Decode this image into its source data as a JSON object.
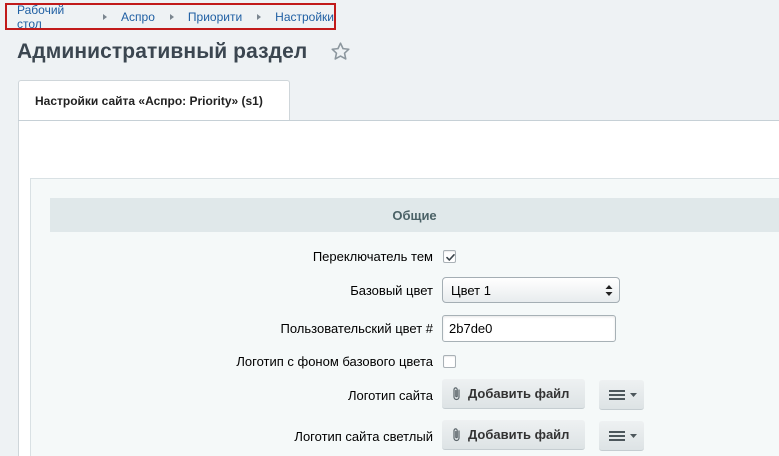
{
  "breadcrumb": {
    "items": [
      "Рабочий стол",
      "Аспро",
      "Приорити",
      "Настройки"
    ]
  },
  "page": {
    "title": "Административный раздел"
  },
  "tabs": [
    {
      "label": "Настройки сайта «Аспро: Priority» (s1)"
    }
  ],
  "section": {
    "title": "Общие"
  },
  "settings": {
    "theme_switcher": {
      "label": "Переключатель тем",
      "checked": true
    },
    "base_color": {
      "label": "Базовый цвет",
      "value": "Цвет 1"
    },
    "custom_color": {
      "label": "Пользовательский цвет #",
      "value": "2b7de0"
    },
    "logo_bg": {
      "label": "Логотип с фоном базового цвета",
      "checked": false
    },
    "logo": {
      "label": "Логотип сайта",
      "button": "Добавить файл"
    },
    "logo_light": {
      "label": "Логотип сайта светлый",
      "button": "Добавить файл"
    }
  },
  "colors": {
    "breadcrumb_link": "#1f5fa3",
    "highlight_border": "#c11a1a",
    "section_header_bg": "#e0e8ea"
  }
}
